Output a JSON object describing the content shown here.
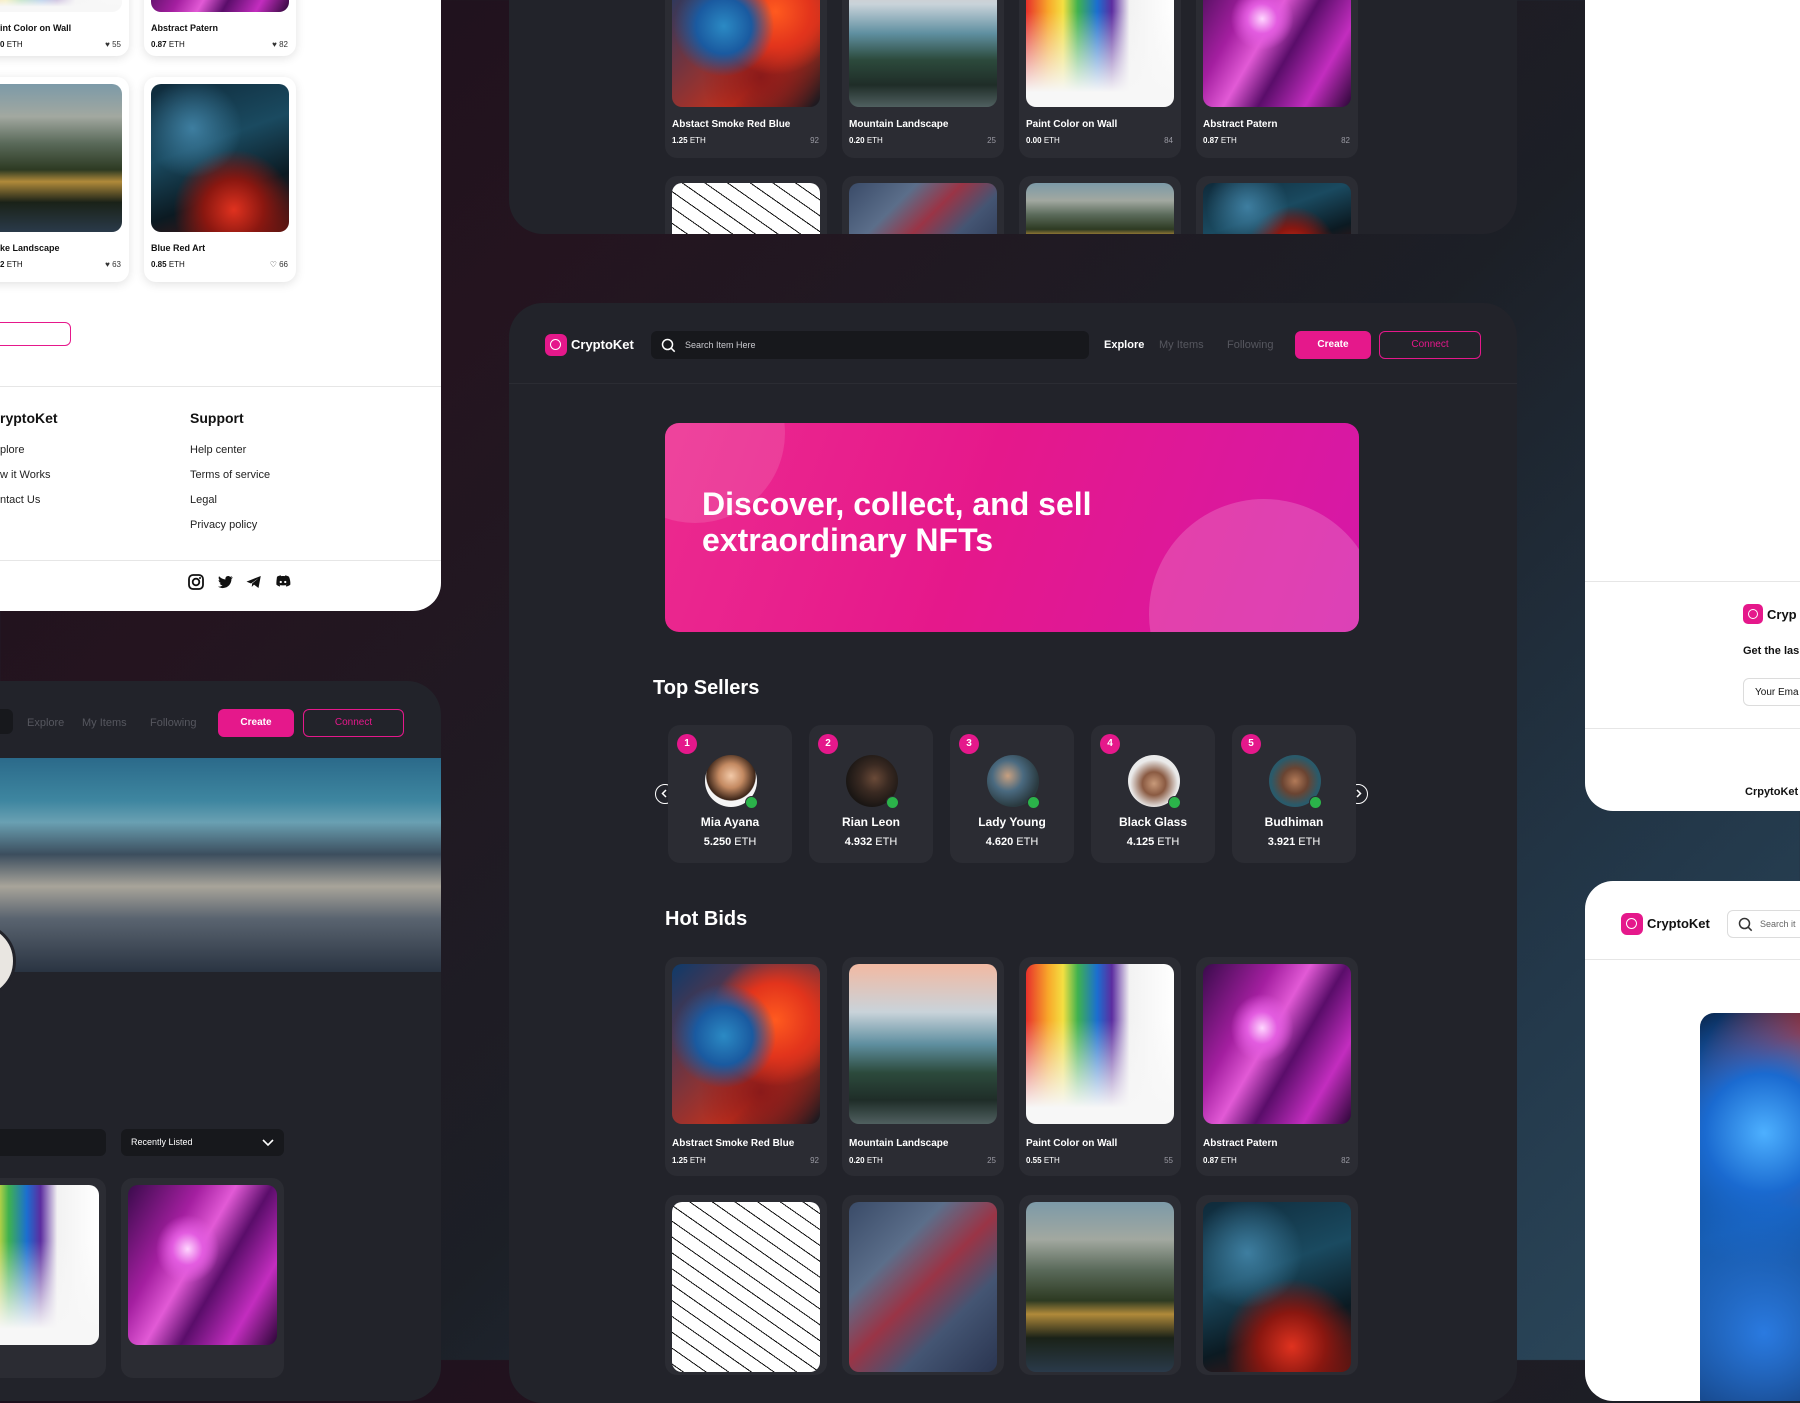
{
  "colors": {
    "accent": "#e5188b",
    "panel": "#22232a",
    "card": "#2b2c33"
  },
  "brand": {
    "name": "CryptoKet"
  },
  "nav": {
    "explore": "Explore",
    "my_items": "My Items",
    "following": "Following",
    "create": "Create",
    "connect": "Connect"
  },
  "search": {
    "placeholder": "Search Item Here"
  },
  "hero": {
    "line1": "Discover, collect, and sell",
    "line2": "extraordinary NFTs"
  },
  "top_sellers": {
    "title": "Top Sellers",
    "sellers": [
      {
        "rank": "1",
        "name": "Mia Ayana",
        "amount": "5.250",
        "unit": "ETH"
      },
      {
        "rank": "2",
        "name": "Rian Leon",
        "amount": "4.932",
        "unit": "ETH"
      },
      {
        "rank": "3",
        "name": "Lady Young",
        "amount": "4.620",
        "unit": "ETH"
      },
      {
        "rank": "4",
        "name": "Black Glass",
        "amount": "4.125",
        "unit": "ETH"
      },
      {
        "rank": "5",
        "name": "Budhiman",
        "amount": "3.921",
        "unit": "ETH"
      }
    ]
  },
  "hot_bids": {
    "title": "Hot Bids",
    "items": [
      {
        "name": "Abstract Smoke Red Blue",
        "price": "1.25",
        "unit": "ETH",
        "likes": "92"
      },
      {
        "name": "Mountain Landscape",
        "price": "0.20",
        "unit": "ETH",
        "likes": "25"
      },
      {
        "name": "Paint Color on Wall",
        "price": "0.55",
        "unit": "ETH",
        "likes": "55"
      },
      {
        "name": "Abstract Patern",
        "price": "0.87",
        "unit": "ETH",
        "likes": "82"
      }
    ]
  },
  "top_panel": {
    "items": [
      {
        "name": "Abstact Smoke Red Blue",
        "price": "1.25",
        "unit": "ETH",
        "likes": "92"
      },
      {
        "name": "Mountain Landscape",
        "price": "0.20",
        "unit": "ETH",
        "likes": "25"
      },
      {
        "name": "Paint Color on Wall",
        "price": "0.00",
        "unit": "ETH",
        "likes": "84"
      },
      {
        "name": "Abstract Patern",
        "price": "0.87",
        "unit": "ETH",
        "likes": "82"
      }
    ]
  },
  "left_light": {
    "items": [
      {
        "name": "int Color on Wall",
        "price": "0",
        "unit": "ETH",
        "likes": "55"
      },
      {
        "name": "Abstract Patern",
        "price": "0.87",
        "unit": "ETH",
        "likes": "82"
      },
      {
        "name": "ke Landscape",
        "price": "2",
        "unit": "ETH",
        "likes": "63"
      },
      {
        "name": "Blue Red Art",
        "price": "0.85",
        "unit": "ETH",
        "likes": "66"
      }
    ],
    "footer_col1_title": "ryptoKet",
    "footer_col1": [
      "plore",
      "w it Works",
      "ntact Us"
    ],
    "footer_col2_title": "Support",
    "footer_col2": [
      "Help center",
      "Terms of service",
      "Legal",
      "Privacy policy"
    ]
  },
  "left_dark": {
    "nav_explore": "Explore",
    "nav_my_items": "My Items",
    "nav_following": "Following",
    "create": "Create",
    "connect": "Connect",
    "sort_label": "Recently Listed"
  },
  "right_light": {
    "brand": "Cryp",
    "newsletter": "Get the las",
    "email_placeholder": "Your Ema",
    "footer_brand": "CrpytoKet"
  },
  "right_bottom": {
    "brand": "CryptoKet",
    "search_placeholder": "Search it"
  }
}
